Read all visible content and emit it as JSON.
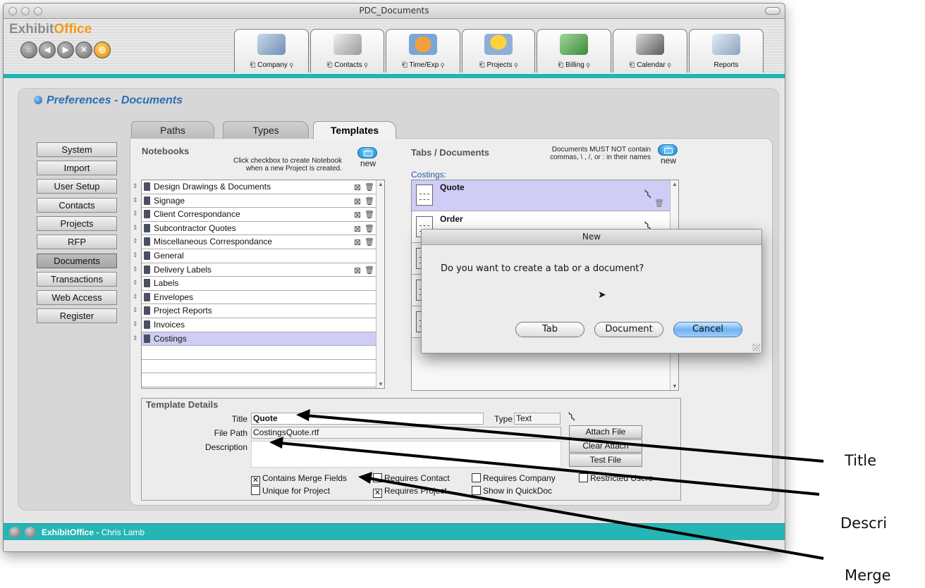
{
  "window": {
    "title": "PDC_Documents"
  },
  "app": {
    "logo_part1": "Exhibit",
    "logo_part2": "Office"
  },
  "modules": [
    {
      "label": "Company",
      "icon": "buildings-icon"
    },
    {
      "label": "Contacts",
      "icon": "phone-icon"
    },
    {
      "label": "Time/Exp",
      "icon": "clock-icon"
    },
    {
      "label": "Projects",
      "icon": "hardhat-icon"
    },
    {
      "label": "Billing",
      "icon": "money-icon"
    },
    {
      "label": "Calendar",
      "icon": "calendar-icon"
    },
    {
      "label": "Reports",
      "icon": "reports-icon"
    }
  ],
  "page": {
    "title": "Preferences - Documents"
  },
  "sidebar": {
    "items": [
      "System",
      "Import",
      "User Setup",
      "Contacts",
      "Projects",
      "RFP",
      "Documents",
      "Transactions",
      "Web Access",
      "Register"
    ],
    "selected": "Documents"
  },
  "tabs": {
    "paths": "Paths",
    "types": "Types",
    "templates": "Templates",
    "selected": "Templates"
  },
  "notebooks": {
    "header": "Notebooks",
    "hint_line1": "Click checkbox to create Notebook",
    "hint_line2": "when a new Project is created.",
    "new_label": "new",
    "items": [
      {
        "name": "Design Drawings & Documents",
        "checkbox": "⊠",
        "trash": "🗑"
      },
      {
        "name": "Signage",
        "checkbox": "⊠",
        "trash": "🗑"
      },
      {
        "name": "Client Correspondance",
        "checkbox": "⊠",
        "trash": "🗑"
      },
      {
        "name": "Subcontractor Quotes",
        "checkbox": "⊠",
        "trash": "🗑"
      },
      {
        "name": "Miscellaneous Correspondance",
        "checkbox": "⊠",
        "trash": "🗑"
      },
      {
        "name": "General",
        "checkbox": "",
        "trash": ""
      },
      {
        "name": "Delivery Labels",
        "checkbox": "⊠",
        "trash": "🗑"
      },
      {
        "name": "Labels",
        "checkbox": "",
        "trash": ""
      },
      {
        "name": "Envelopes",
        "checkbox": "",
        "trash": ""
      },
      {
        "name": "Project Reports",
        "checkbox": "",
        "trash": ""
      },
      {
        "name": "Invoices",
        "checkbox": "",
        "trash": ""
      },
      {
        "name": "Costings",
        "checkbox": "",
        "trash": ""
      }
    ],
    "selected": "Costings"
  },
  "tabs_documents": {
    "header": "Tabs / Documents",
    "note_line1": "Documents MUST NOT contain",
    "note_line2": "commas, \\ , /, or : in their names",
    "new_label": "new",
    "current_tab": "Costings:",
    "items": [
      "Quote",
      "Order"
    ],
    "selected": "Quote"
  },
  "template_details": {
    "header": "Template Details",
    "title_label": "Title",
    "title_value": "Quote",
    "type_label": "Type",
    "type_value": "Text",
    "file_path_label": "File Path",
    "file_path_value": "CostingsQuote.rtf",
    "description_label": "Description",
    "description_value": "",
    "buttons": {
      "attach": "Attach File",
      "clear": "Clear Attach",
      "test": "Test File"
    },
    "checkboxes": [
      {
        "label": "Contains Merge Fields",
        "checked": true
      },
      {
        "label": "Requires Contact",
        "checked": false
      },
      {
        "label": "Requires Company",
        "checked": false
      },
      {
        "label": "Restricted Users",
        "checked": false
      },
      {
        "label": "Unique for Project",
        "checked": false
      },
      {
        "label": "Requires Project",
        "checked": true
      },
      {
        "label": "Show in QuickDoc",
        "checked": false
      }
    ]
  },
  "dialog": {
    "title": "New",
    "message": "Do you want to create a tab or a document?",
    "buttons": {
      "tab": "Tab",
      "document": "Document",
      "cancel": "Cancel"
    },
    "default_button": "Cancel"
  },
  "footer": {
    "app": "ExhibitOffice",
    "separator": " - ",
    "user": "Chris Lamb"
  },
  "annotations": {
    "title": "Title",
    "description": "Descri",
    "merge": "Merge"
  },
  "colors": {
    "accent_teal": "#22b3b3",
    "selection": "#cfcdf5",
    "title_blue": "#2a6fb4",
    "logo_orange": "#f39b14"
  }
}
